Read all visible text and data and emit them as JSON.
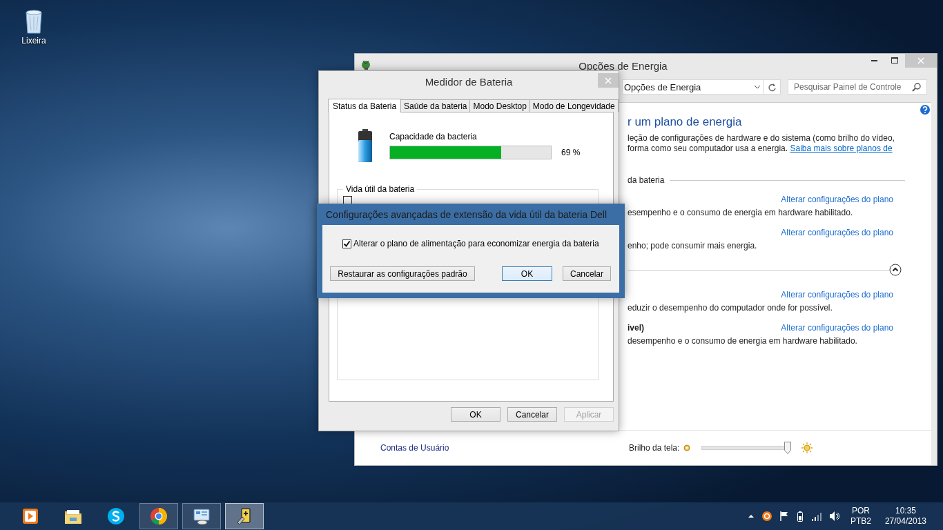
{
  "desktop": {
    "icons": [
      {
        "label": "Lixeira"
      }
    ]
  },
  "power_window": {
    "title": "Opções de Energia",
    "address": "Opções de Energia",
    "search": {
      "placeholder": "Pesquisar Painel de Controle"
    },
    "heading": "r um plano de energia",
    "intro_lines": [
      "leção de configurações de hardware e do sistema (como brilho do vídeo,",
      "forma como seu computador usa a energia."
    ],
    "intro_link": "Saiba mais sobre planos de",
    "section": "da bateria",
    "plans": [
      {
        "link": "Alterar configurações do plano",
        "description": "esempenho e o consumo de energia em hardware habilitado."
      },
      {
        "link": "Alterar configurações do plano",
        "description": "enho; pode consumir mais energia."
      },
      {
        "link": "Alterar configurações do plano",
        "description": "eduzir o desempenho do computador onde for possível."
      },
      {
        "name": "ivel)",
        "link": "Alterar configurações do plano",
        "description": "desempenho e o consumo de energia em hardware habilitado."
      }
    ],
    "more_plans": {
      "expanded": true
    },
    "nav_link": "Contas de Usuário",
    "brightness": {
      "label": "Brilho da tela:",
      "level": 0.97
    }
  },
  "battery_window": {
    "title": "Medidor de Bateria",
    "tabs": [
      {
        "label": "Status da Bateria",
        "selected": true
      },
      {
        "label": "Saúde da bateria",
        "selected": false
      },
      {
        "label": "Modo Desktop",
        "selected": false
      },
      {
        "label": "Modo de Longevidade",
        "selected": false
      }
    ],
    "capacity": {
      "label": "Capacidade da bacteria",
      "level": 0.69,
      "reading": "69 %"
    },
    "group": {
      "label": "Vida útil da bateria",
      "checked": false
    },
    "buttons": [
      {
        "label": "OK",
        "disabled": false
      },
      {
        "label": "Cancelar",
        "disabled": false
      },
      {
        "label": "Aplicar",
        "disabled": true
      }
    ]
  },
  "dell_dialog": {
    "title": "Configurações avançadas de extensão da vida útil da bateria Dell",
    "option": {
      "label": "Alterar o plano de alimentação para economizar energia da bateria",
      "checked": true
    },
    "buttons": [
      {
        "label": "Restaurar as configurações padrão",
        "default": false
      },
      {
        "label": "OK",
        "default": true
      },
      {
        "label": "Cancelar",
        "default": false
      }
    ]
  },
  "taskbar": {
    "apps": [
      {
        "kind": "media",
        "running": false,
        "selected": false
      },
      {
        "kind": "explorer",
        "running": false,
        "selected": false
      },
      {
        "kind": "skype",
        "running": false,
        "selected": false
      },
      {
        "kind": "chrome",
        "running": true,
        "selected": false
      },
      {
        "kind": "control-panel",
        "running": true,
        "selected": false
      },
      {
        "kind": "battery",
        "running": true,
        "selected": true
      }
    ],
    "language": [
      "POR",
      "PTB2"
    ],
    "time": "10:35",
    "date": "27/04/2013"
  }
}
